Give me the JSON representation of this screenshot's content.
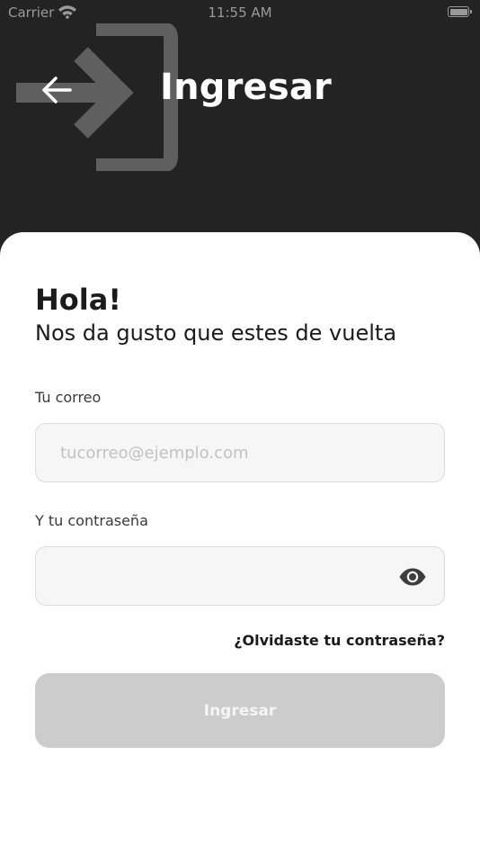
{
  "status_bar": {
    "carrier": "Carrier",
    "time": "11:55 AM",
    "icons": [
      "wifi-icon",
      "battery-icon"
    ]
  },
  "header": {
    "title": "Ingresar",
    "background_color": "#232323",
    "icons": [
      "arrow-left-icon",
      "login-icon"
    ]
  },
  "form": {
    "greeting": "Hola!",
    "subtitle": "Nos da gusto que estes de vuelta",
    "email_label": "Tu correo",
    "email_placeholder": "tucorreo@ejemplo.com",
    "email_value": "",
    "password_label": "Y tu contraseña",
    "password_value": "",
    "forgot_password": "¿Olvidaste tu contraseña?",
    "submit_label": "Ingresar",
    "submit_color": "#cccccc",
    "submit_enabled": false
  }
}
